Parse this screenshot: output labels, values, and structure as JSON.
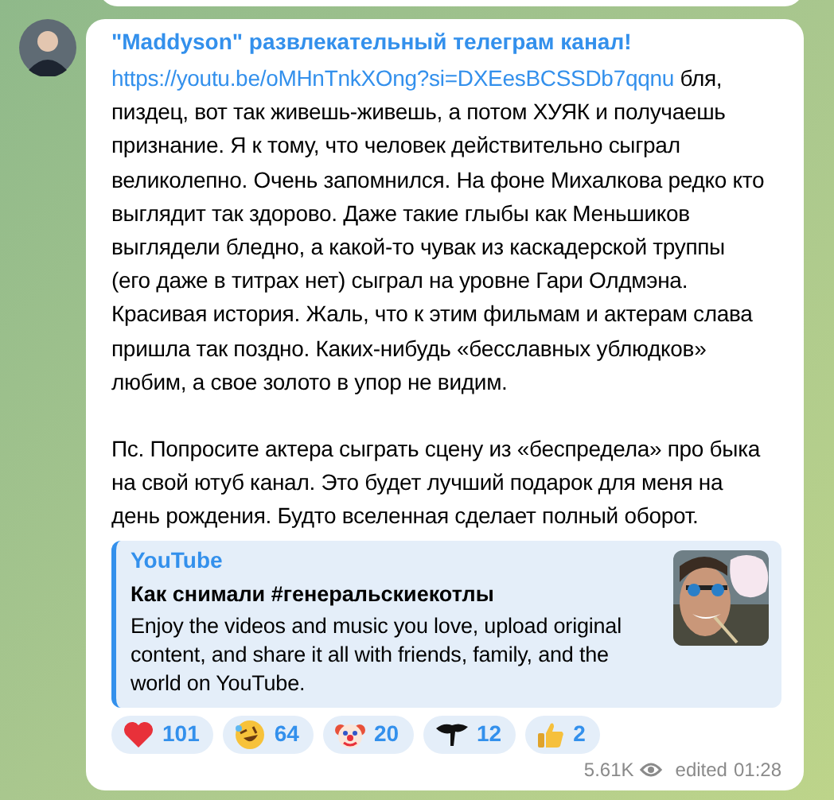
{
  "message": {
    "sender": "\"Maddyson\" развлекательный телеграм канал!",
    "paragraphs": [
      {
        "link": "https://youtu.be/oMHnTnkXOng?si=DXEesBCSSDb7qqnu",
        "text": " бля, пиздец, вот так живешь-живешь, а потом ХУЯК и получаешь признание. Я к тому, что человек действительно сыграл великолепно. Очень запомнился. На фоне Михалкова редко кто выглядит так здорово. Даже такие глыбы как Меньшиков выглядели бледно, а какой-то чувак из каскадерской труппы (его даже в титрах нет) сыграл на уровне Гари Олдмэна. Красивая история. Жаль, что к этим фильмам и актерам слава пришла так поздно. Каких-нибудь «бесславных ублюдков» любим, а свое золото в упор не видим."
      },
      {
        "text": "Пс. Попросите актера сыграть сцену из «беспредела» про быка на свой ютуб канал. Это будет лучший подарок для меня на день рождения. Будто вселенная сделает полный оборот."
      }
    ],
    "preview": {
      "site": "YouTube",
      "title": "Как снимали #генеральскиекотлы",
      "description": "Enjoy the videos and music you love, upload original content, and share it all with friends, family, and the world on YouTube."
    },
    "reactions": [
      {
        "kind": "heart",
        "count": "101"
      },
      {
        "kind": "rofl",
        "count": "64"
      },
      {
        "kind": "clown",
        "count": "20"
      },
      {
        "kind": "bird",
        "count": "12"
      },
      {
        "kind": "thumbs-up",
        "count": "2"
      }
    ],
    "views": "5.61K",
    "edited": "edited",
    "time": "01:28"
  }
}
